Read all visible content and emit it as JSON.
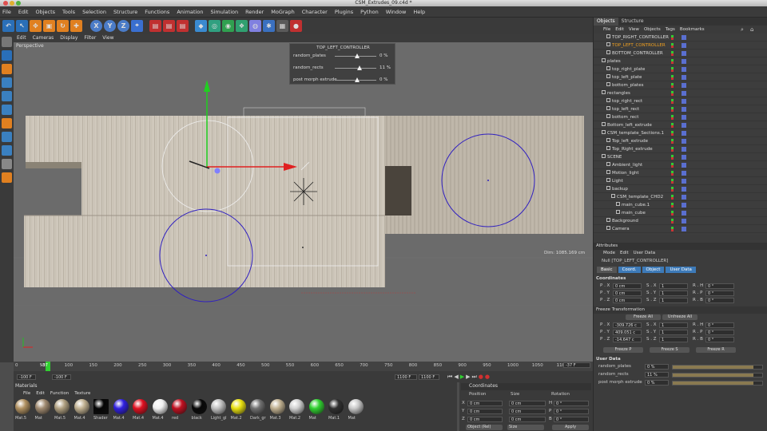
{
  "window": {
    "title": "CSM_Extrudes_09.c4d *"
  },
  "menubar": [
    "File",
    "Edit",
    "Objects",
    "Tools",
    "Selection",
    "Structure",
    "Functions",
    "Animation",
    "Simulation",
    "Render",
    "MoGraph",
    "Character",
    "Plugins",
    "Python",
    "Window",
    "Help"
  ],
  "toolbar": {
    "axis": [
      "X",
      "Y",
      "Z"
    ]
  },
  "viewport": {
    "menu": [
      "Edit",
      "Cameras",
      "Display",
      "Filter",
      "View"
    ],
    "label": "Perspective",
    "dimension": "Dim: 1085.169 cm",
    "controller": {
      "title": "TOP_LEFT_CONTROLLER",
      "rows": [
        {
          "label": "random_plates",
          "value": "0 %",
          "level": 0.48
        },
        {
          "label": "random_rects",
          "value": "11 %",
          "level": 0.53
        },
        {
          "label": "post morph extrude",
          "value": "0 %",
          "level": 0.48
        }
      ]
    }
  },
  "timeline": {
    "ticks": [
      "0",
      "50",
      "100",
      "150",
      "200",
      "250",
      "300",
      "350",
      "400",
      "450",
      "500",
      "550",
      "600",
      "650",
      "700",
      "750",
      "800",
      "850",
      "900",
      "950",
      "1000",
      "1050",
      "1100"
    ],
    "current": "-37",
    "frame_field": "-37 F",
    "start": "-100 F",
    "start2": "-100 F",
    "end": "1100 F",
    "end2": "1100 F"
  },
  "panel": {
    "tabs": [
      "Objects",
      "Structure"
    ],
    "obj_menu": [
      "File",
      "Edit",
      "View",
      "Objects",
      "Tags",
      "Bookmarks"
    ],
    "objects": [
      {
        "name": "TOP_RIGHT_CONTROLLER",
        "indent": 1,
        "color": "#dddddd"
      },
      {
        "name": "TOP_LEFT_CONTROLLER",
        "indent": 1,
        "color": "#f0a020"
      },
      {
        "name": "BOTTOM_CONTROLLER",
        "indent": 1,
        "color": "#dddddd"
      },
      {
        "name": "plates",
        "indent": 0,
        "color": "#dddddd"
      },
      {
        "name": "top_right_plate",
        "indent": 1,
        "color": "#dddddd"
      },
      {
        "name": "top_left_plate",
        "indent": 1,
        "color": "#dddddd"
      },
      {
        "name": "bottom_plates",
        "indent": 1,
        "color": "#dddddd"
      },
      {
        "name": "rectangles",
        "indent": 0,
        "color": "#dddddd"
      },
      {
        "name": "top_right_rect",
        "indent": 1,
        "color": "#dddddd"
      },
      {
        "name": "top_left_rect",
        "indent": 1,
        "color": "#dddddd"
      },
      {
        "name": "bottom_rect",
        "indent": 1,
        "color": "#dddddd"
      },
      {
        "name": "Bottom_left_extrude",
        "indent": 0,
        "color": "#dddddd"
      },
      {
        "name": "CSM_template_Sections.1",
        "indent": 0,
        "color": "#dddddd"
      },
      {
        "name": "Top_left_extrude",
        "indent": 1,
        "color": "#dddddd"
      },
      {
        "name": "Top_Right_extrude",
        "indent": 1,
        "color": "#dddddd"
      },
      {
        "name": "SCENE",
        "indent": 0,
        "color": "#dddddd"
      },
      {
        "name": "Ambient_light",
        "indent": 1,
        "color": "#dddddd"
      },
      {
        "name": "Motion_light",
        "indent": 1,
        "color": "#dddddd"
      },
      {
        "name": "Light",
        "indent": 1,
        "color": "#dddddd"
      },
      {
        "name": "backup",
        "indent": 1,
        "color": "#dddddd"
      },
      {
        "name": "CSM_template_CHD2",
        "indent": 2,
        "color": "#dddddd"
      },
      {
        "name": "main_cube.1",
        "indent": 3,
        "color": "#dddddd"
      },
      {
        "name": "main_cube",
        "indent": 3,
        "color": "#dddddd"
      },
      {
        "name": "Background",
        "indent": 1,
        "color": "#dddddd"
      },
      {
        "name": "Camera",
        "indent": 1,
        "color": "#dddddd"
      }
    ],
    "attributes": {
      "title": "Attributes",
      "menu": [
        "Mode",
        "Edit",
        "User Data"
      ],
      "object": "Null [TOP_LEFT_CONTROLLER]",
      "tabs": [
        "Basic",
        "Coord.",
        "Object",
        "User Data"
      ],
      "coord_title": "Coordinates",
      "pos": [
        {
          "axis": "P . X",
          "value": "0 cm"
        },
        {
          "axis": "P . Y",
          "value": "0 cm"
        },
        {
          "axis": "P . Z",
          "value": "0 cm"
        }
      ],
      "scale": [
        {
          "axis": "S . X",
          "value": "1"
        },
        {
          "axis": "S . Y",
          "value": "1"
        },
        {
          "axis": "S . Z",
          "value": "1"
        }
      ],
      "rot": [
        {
          "axis": "R . H",
          "value": "0 °"
        },
        {
          "axis": "R . P",
          "value": "0 °"
        },
        {
          "axis": "R . B",
          "value": "0 °"
        }
      ],
      "freeze_title": "Freeze Transformation",
      "freeze_all": "Freeze All",
      "unfreeze_all": "Unfreeze All",
      "fpos": [
        {
          "axis": "P . X",
          "value": "-309.726 c"
        },
        {
          "axis": "P . Y",
          "value": "409.051 c"
        },
        {
          "axis": "P . Z",
          "value": "-14.647 c"
        }
      ],
      "fscale": [
        {
          "axis": "S . X",
          "value": "1"
        },
        {
          "axis": "S . Y",
          "value": "1"
        },
        {
          "axis": "S . Z",
          "value": "1"
        }
      ],
      "frot": [
        {
          "axis": "R . H",
          "value": "0 °"
        },
        {
          "axis": "R . P",
          "value": "0 °"
        },
        {
          "axis": "R . B",
          "value": "0 °"
        }
      ],
      "freeze_buttons": [
        "Freeze P",
        "Freeze S",
        "Freeze R"
      ],
      "userdata_title": "User Data",
      "userdata": [
        {
          "label": "random_plates",
          "value": "0 %",
          "level": 0.9
        },
        {
          "label": "random_rects",
          "value": "11 %",
          "level": 0.9
        },
        {
          "label": "post morph extrude",
          "value": "0 %",
          "level": 0.9
        }
      ]
    }
  },
  "materials": {
    "title": "Materials",
    "menu": [
      "File",
      "Edit",
      "Function",
      "Texture"
    ],
    "items": [
      {
        "name": "Mat.5",
        "color": "#b09060"
      },
      {
        "name": "Mat",
        "color": "#a08a70"
      },
      {
        "name": "Mat.5",
        "color": "#b0a080"
      },
      {
        "name": "Mat.4",
        "color": "#c0b090"
      },
      {
        "name": "Shader",
        "color": "#050505"
      },
      {
        "name": "Mat.4",
        "color": "#3020e0"
      },
      {
        "name": "Mat.4",
        "color": "#e01020"
      },
      {
        "name": "Mat.4",
        "color": "#f0f0f0"
      },
      {
        "name": "red",
        "color": "#c01020"
      },
      {
        "name": "black",
        "color": "#080808"
      },
      {
        "name": "Light_gl",
        "color": "#c0c0c0"
      },
      {
        "name": "Mat.2",
        "color": "#e8e010"
      },
      {
        "name": "Dark_gr",
        "color": "#707070"
      },
      {
        "name": "Mat.3",
        "color": "#c0b090"
      },
      {
        "name": "Mat.2",
        "color": "#d0d0d0"
      },
      {
        "name": "Mat",
        "color": "#30d030"
      },
      {
        "name": "Mat.1",
        "color": "#303030"
      },
      {
        "name": "Mat",
        "color": "#c8c8c8"
      }
    ]
  },
  "coordinates": {
    "title": "Coordinates",
    "headers": [
      "Position",
      "Size",
      "Rotation"
    ],
    "rows": [
      {
        "axis": "X",
        "pos": "0 cm",
        "size": "0 cm",
        "rlabel": "H",
        "rot": "0 °"
      },
      {
        "axis": "Y",
        "pos": "0 cm",
        "size": "0 cm",
        "rlabel": "P",
        "rot": "0 °"
      },
      {
        "axis": "Z",
        "pos": "0 cm",
        "size": "0 cm",
        "rlabel": "B",
        "rot": "0 °"
      }
    ],
    "mode": "Object (Rel)",
    "size_mode": "Size",
    "apply": "Apply"
  },
  "colors": {
    "accent": "#2a6fb8",
    "highlight": "#f0a020",
    "active_tab": "#3d7ab8"
  }
}
